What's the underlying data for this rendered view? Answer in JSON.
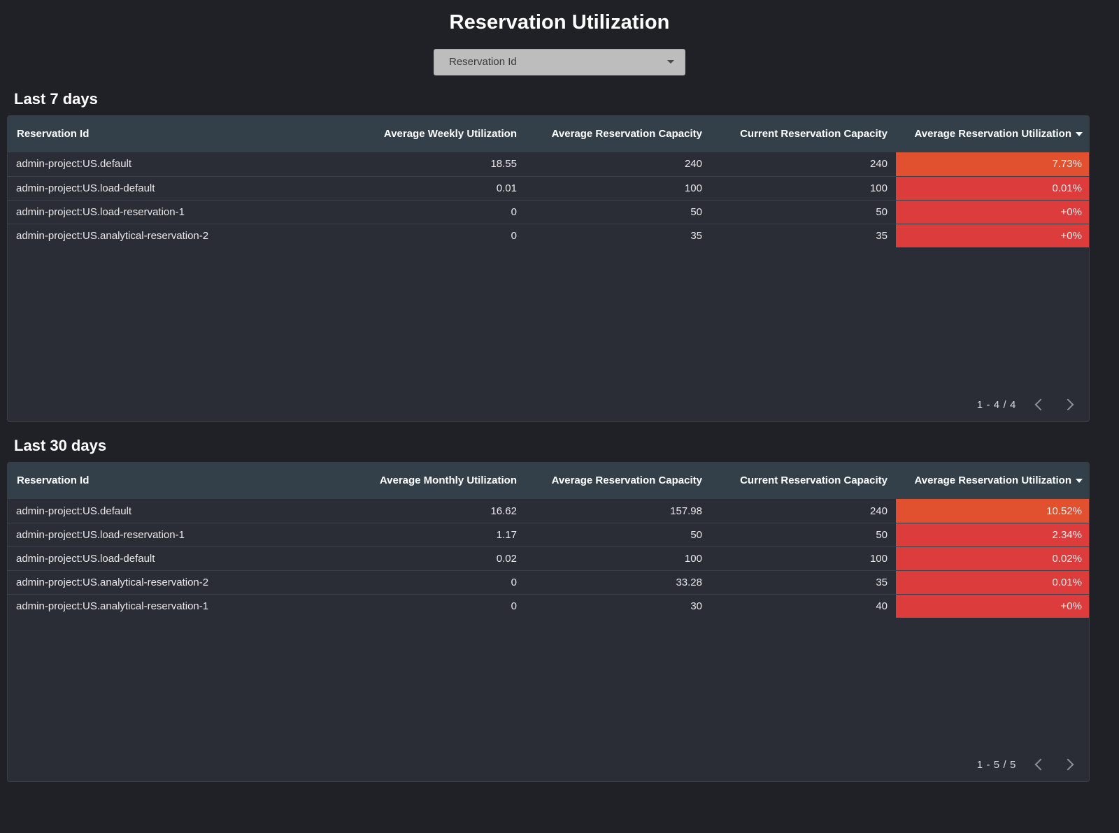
{
  "header": {
    "title": "Reservation Utilization"
  },
  "filter": {
    "name": "reservation-id-filter",
    "label": "Reservation Id",
    "icon": "chevron-down-icon"
  },
  "colors": {
    "page_background": "#1f2126",
    "panel_background": "#2a2d36",
    "table_header": "#33404a",
    "util_high": "#e2512f",
    "util_low": "#dc3c3c",
    "text_primary": "#ffffff"
  },
  "sections": [
    {
      "id": "last-7-days",
      "title": "Last 7 days",
      "columns": [
        "Reservation Id",
        "Average Weekly Utilization",
        "Average Reservation Capacity",
        "Current Reservation Capacity",
        "Average Reservation Utilization"
      ],
      "sorted_column": "Average Reservation Utilization",
      "sort_direction": "desc",
      "rows": [
        {
          "reservation_id": "admin-project:US.default",
          "average_utilization": "18.55",
          "average_capacity": "240",
          "current_capacity": "240",
          "average_reservation_utilization": "7.73%",
          "util_color": "#e2512f"
        },
        {
          "reservation_id": "admin-project:US.load-default",
          "average_utilization": "0.01",
          "average_capacity": "100",
          "current_capacity": "100",
          "average_reservation_utilization": "0.01%",
          "util_color": "#dc3c3c"
        },
        {
          "reservation_id": "admin-project:US.load-reservation-1",
          "average_utilization": "0",
          "average_capacity": "50",
          "current_capacity": "50",
          "average_reservation_utilization": "+0%",
          "util_color": "#dc3c3c"
        },
        {
          "reservation_id": "admin-project:US.analytical-reservation-2",
          "average_utilization": "0",
          "average_capacity": "35",
          "current_capacity": "35",
          "average_reservation_utilization": "+0%",
          "util_color": "#dc3c3c"
        }
      ],
      "pagination": {
        "range_label": "1 - 4 / 4",
        "prev_icon": "chevron-left-icon",
        "next_icon": "chevron-right-icon"
      }
    },
    {
      "id": "last-30-days",
      "title": "Last 30 days",
      "columns": [
        "Reservation Id",
        "Average Monthly Utilization",
        "Average Reservation Capacity",
        "Current Reservation Capacity",
        "Average Reservation Utilization"
      ],
      "sorted_column": "Average Reservation Utilization",
      "sort_direction": "desc",
      "rows": [
        {
          "reservation_id": "admin-project:US.default",
          "average_utilization": "16.62",
          "average_capacity": "157.98",
          "current_capacity": "240",
          "average_reservation_utilization": "10.52%",
          "util_color": "#e2512f"
        },
        {
          "reservation_id": "admin-project:US.load-reservation-1",
          "average_utilization": "1.17",
          "average_capacity": "50",
          "current_capacity": "50",
          "average_reservation_utilization": "2.34%",
          "util_color": "#dc3c3c"
        },
        {
          "reservation_id": "admin-project:US.load-default",
          "average_utilization": "0.02",
          "average_capacity": "100",
          "current_capacity": "100",
          "average_reservation_utilization": "0.02%",
          "util_color": "#dc3c3c"
        },
        {
          "reservation_id": "admin-project:US.analytical-reservation-2",
          "average_utilization": "0",
          "average_capacity": "33.28",
          "current_capacity": "35",
          "average_reservation_utilization": "0.01%",
          "util_color": "#dc3c3c"
        },
        {
          "reservation_id": "admin-project:US.analytical-reservation-1",
          "average_utilization": "0",
          "average_capacity": "30",
          "current_capacity": "40",
          "average_reservation_utilization": "+0%",
          "util_color": "#dc3c3c"
        }
      ],
      "pagination": {
        "range_label": "1 - 5 / 5",
        "prev_icon": "chevron-left-icon",
        "next_icon": "chevron-right-icon"
      }
    }
  ]
}
